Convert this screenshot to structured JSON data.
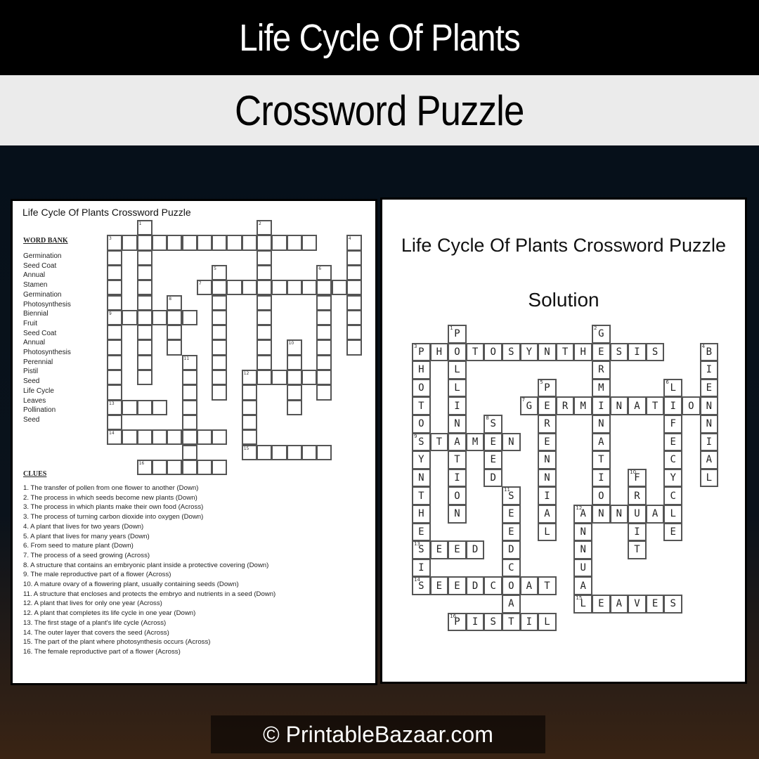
{
  "header": {
    "title": "Life Cycle Of Plants",
    "subtitle": "Crossword Puzzle"
  },
  "puzzle_page": {
    "title": "Life Cycle Of Plants Crossword Puzzle",
    "word_bank_heading": "WORD BANK",
    "word_bank": [
      "Germination",
      "Seed Coat",
      "Annual",
      "Stamen",
      "Germination",
      "Photosynthesis",
      "Biennial",
      "Fruit",
      "Seed Coat",
      "Annual",
      "Photosynthesis",
      "Perennial",
      "Pistil",
      "Seed",
      "Life Cycle",
      "Leaves",
      "Pollination",
      "Seed"
    ],
    "clues_heading": "CLUES",
    "clues": [
      "1. The transfer of pollen from one flower to another (Down)",
      "2. The process in which seeds become new plants (Down)",
      "3. The process in which plants make their own food (Across)",
      "3. The process of turning carbon dioxide into oxygen (Down)",
      "4. A plant that lives for two years (Down)",
      "5. A plant that lives for many years (Down)",
      "6. From seed to mature plant (Down)",
      "7. The process of a seed growing (Across)",
      "8. A structure that contains an embryonic plant inside a protective covering (Down)",
      "9. The male reproductive  part of a flower (Across)",
      "10. A mature ovary of a flowering plant, usually containing seeds (Down)",
      "11. A structure that encloses and protects the embryo  and nutrients  in a seed (Down)",
      "12. A plant that lives for only one year (Across)",
      "12. A plant that completes its life cycle in one year (Down)",
      "13. The first stage of a plant's life cycle (Across)",
      "14. The outer layer that covers the seed (Across)",
      "15. The part of the plant where photosynthesis occurs (Across)",
      "16. The female reproductive  part of a flower (Across)"
    ]
  },
  "solution_page": {
    "title": "Life Cycle Of Plants Crossword Puzzle",
    "subtitle": "Solution"
  },
  "crossword": {
    "entries": [
      {
        "num": "1",
        "dir": "down",
        "col": 2,
        "row": 0,
        "answer": "POLLINATION"
      },
      {
        "num": "2",
        "dir": "down",
        "col": 10,
        "row": 0,
        "answer": "GERMINATION"
      },
      {
        "num": "3",
        "dir": "across",
        "col": 0,
        "row": 1,
        "answer": "PHOTOSYNTHESIS"
      },
      {
        "num": "3",
        "dir": "down",
        "col": 0,
        "row": 1,
        "answer": "PHOTOSYNTHESIS"
      },
      {
        "num": "4",
        "dir": "down",
        "col": 16,
        "row": 1,
        "answer": "BIENNIAL"
      },
      {
        "num": "5",
        "dir": "down",
        "col": 7,
        "row": 3,
        "answer": "PERENNIAL"
      },
      {
        "num": "6",
        "dir": "down",
        "col": 14,
        "row": 3,
        "answer": "LIFECYCLE"
      },
      {
        "num": "7",
        "dir": "across",
        "col": 6,
        "row": 4,
        "answer": "GERMINATION"
      },
      {
        "num": "8",
        "dir": "down",
        "col": 4,
        "row": 5,
        "answer": "SEED"
      },
      {
        "num": "9",
        "dir": "across",
        "col": 0,
        "row": 6,
        "answer": "STAMEN"
      },
      {
        "num": "10",
        "dir": "down",
        "col": 12,
        "row": 8,
        "answer": "FRUIT"
      },
      {
        "num": "11",
        "dir": "down",
        "col": 5,
        "row": 9,
        "answer": "SEEDCOAT"
      },
      {
        "num": "12",
        "dir": "across",
        "col": 9,
        "row": 10,
        "answer": "ANNUAL"
      },
      {
        "num": "12",
        "dir": "down",
        "col": 9,
        "row": 10,
        "answer": "ANNUAL"
      },
      {
        "num": "13",
        "dir": "across",
        "col": 0,
        "row": 12,
        "answer": "SEED"
      },
      {
        "num": "14",
        "dir": "across",
        "col": 0,
        "row": 14,
        "answer": "SEEDCOAT"
      },
      {
        "num": "15",
        "dir": "across",
        "col": 9,
        "row": 15,
        "answer": "LEAVES"
      },
      {
        "num": "16",
        "dir": "across",
        "col": 2,
        "row": 16,
        "answer": "PISTIL"
      }
    ]
  },
  "footer": {
    "copyright": "© PrintableBazaar.com"
  }
}
